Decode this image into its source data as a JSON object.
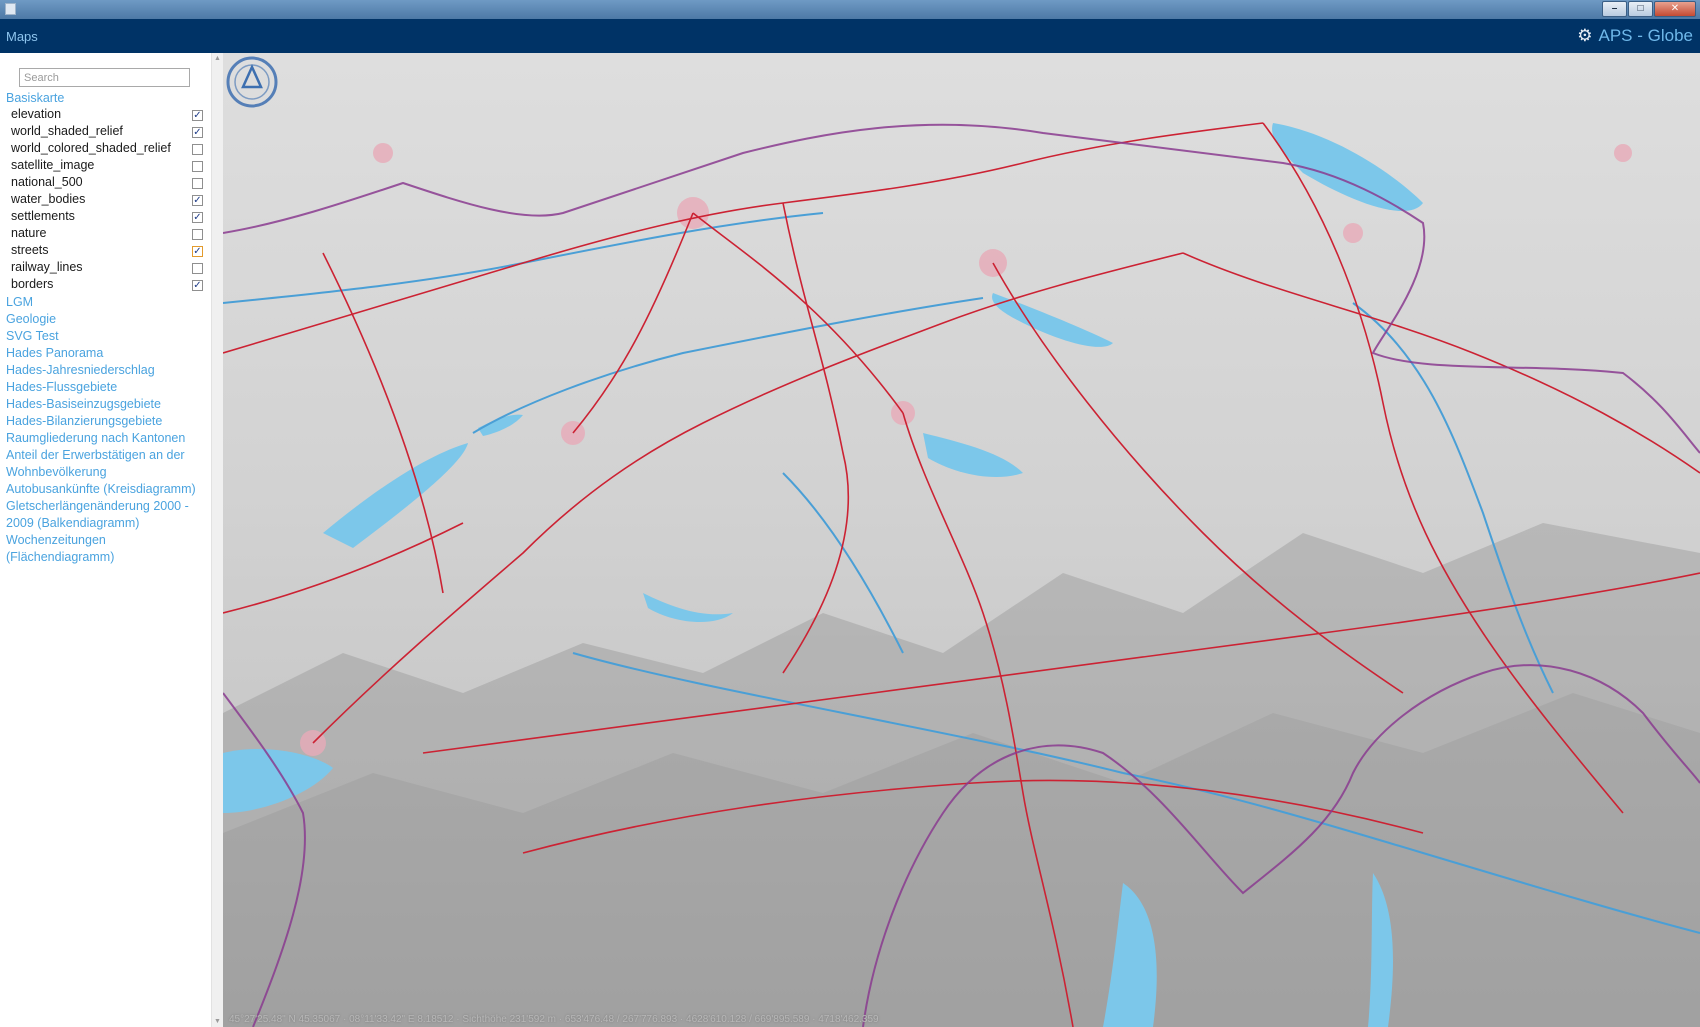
{
  "app": {
    "menu_label": "Maps",
    "brand_title": "APS - Globe"
  },
  "window": {
    "minimize": "–",
    "maximize": "□",
    "close": "✕"
  },
  "sidebar": {
    "search_placeholder": "Search",
    "groups": [
      {
        "label": "Basiskarte"
      },
      {
        "label": "LGM"
      },
      {
        "label": "Geologie"
      },
      {
        "label": "SVG Test"
      },
      {
        "label": "Hades Panorama"
      },
      {
        "label": "Hades-Jahresniederschlag"
      },
      {
        "label": "Hades-Flussgebiete"
      },
      {
        "label": "Hades-Basiseinzugsgebiete"
      },
      {
        "label": "Hades-Bilanzierungsgebiete"
      },
      {
        "label": "Raumgliederung nach Kantonen"
      },
      {
        "label": "Anteil der Erwerbstätigen an der"
      },
      {
        "label": "Wohnbevölkerung"
      },
      {
        "label": "Autobusankünfte (Kreisdiagramm)"
      },
      {
        "label": "Gletscherlängenänderung 2000 -"
      },
      {
        "label": "2009 (Balkendiagramm)"
      },
      {
        "label": "Wochenzeitungen"
      },
      {
        "label": "(Flächendiagramm)"
      }
    ],
    "layers": [
      {
        "label": "elevation",
        "checked": true
      },
      {
        "label": "world_shaded_relief",
        "checked": true
      },
      {
        "label": "world_colored_shaded_relief",
        "checked": false
      },
      {
        "label": "satellite_image",
        "checked": false
      },
      {
        "label": "national_500",
        "checked": false
      },
      {
        "label": "water_bodies",
        "checked": true
      },
      {
        "label": "settlements",
        "checked": true
      },
      {
        "label": "nature",
        "checked": false
      },
      {
        "label": "streets",
        "checked": true
      },
      {
        "label": "railway_lines",
        "checked": false
      },
      {
        "label": "borders",
        "checked": true
      }
    ]
  },
  "map": {
    "coordinates": "45°27'25.48\" N 45.35067 · 08°11'33.42\" E 8.18512 · Sichthöhe 231'592 m · 653'476.48 / 267'776.893 · 4628'610.128 / 669'895.589 · 4718'462.359",
    "colors": {
      "water": "#7cc7ea",
      "roads": "#cc2233",
      "borders": "#8a3b8f",
      "settlements": "#e7aab8",
      "relief": "#d4d4d4"
    }
  }
}
